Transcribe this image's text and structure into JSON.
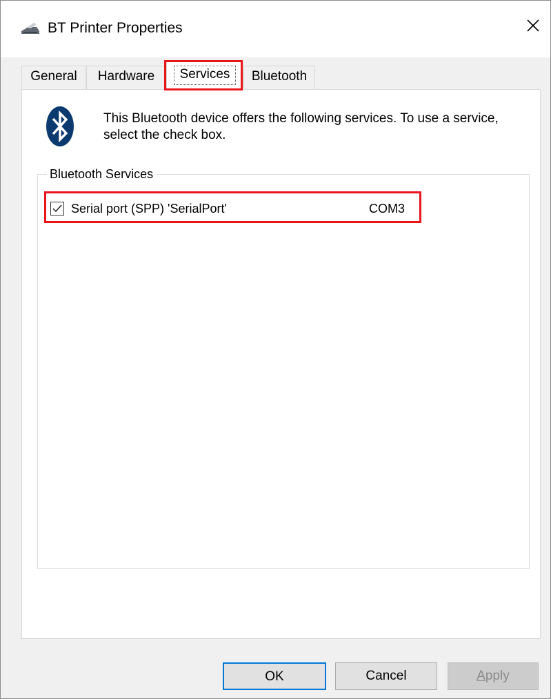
{
  "window": {
    "title": "BT Printer Properties",
    "close_icon": "close-icon",
    "title_icon": "printer-icon"
  },
  "tabs": [
    {
      "label": "General",
      "selected": false
    },
    {
      "label": "Hardware",
      "selected": false
    },
    {
      "label": "Services",
      "selected": true
    },
    {
      "label": "Bluetooth",
      "selected": false
    }
  ],
  "services_page": {
    "icon": "bluetooth-icon",
    "description": "This Bluetooth device offers the following services. To use a service, select the check box.",
    "group_label": "Bluetooth Services",
    "services": [
      {
        "name": "Serial port (SPP) 'SerialPort'",
        "port": "COM3",
        "checked": true
      }
    ]
  },
  "buttons": {
    "ok": "OK",
    "cancel": "Cancel",
    "apply_prefix": "",
    "apply_underlined": "A",
    "apply_rest": "pply"
  },
  "colors": {
    "highlight": "#e8151b",
    "bluetooth_icon": "#0b3a6f",
    "default_button_border": "#0078d7"
  }
}
